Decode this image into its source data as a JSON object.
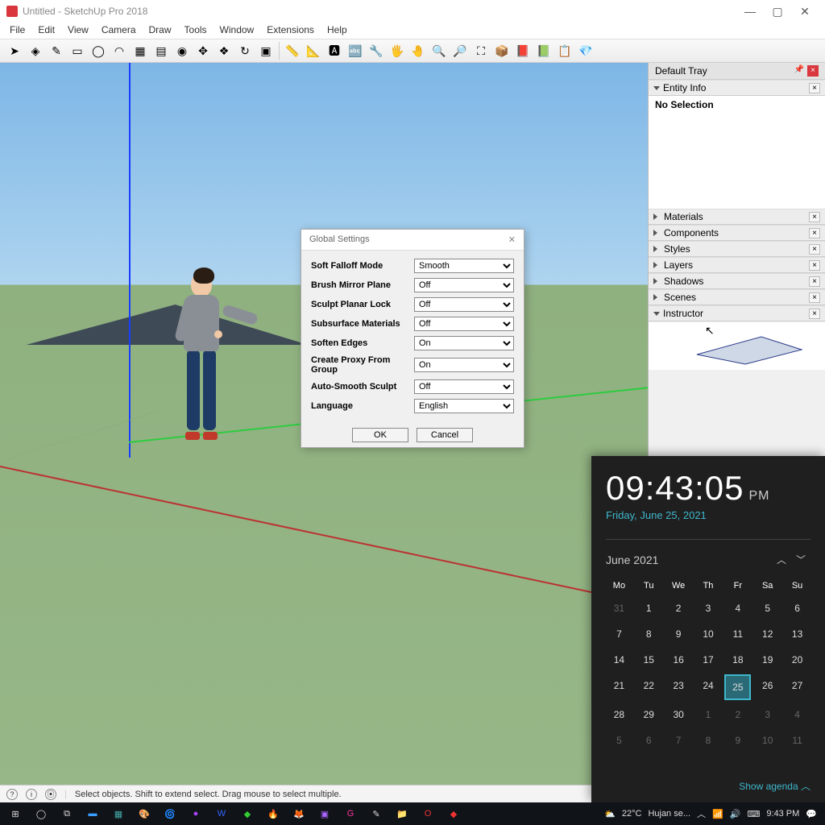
{
  "window": {
    "title": "Untitled - SketchUp Pro 2018"
  },
  "menu": [
    "File",
    "Edit",
    "View",
    "Camera",
    "Draw",
    "Tools",
    "Window",
    "Extensions",
    "Help"
  ],
  "tray": {
    "title": "Default Tray",
    "entity_info": "Entity Info",
    "no_selection": "No Selection",
    "panels": [
      "Materials",
      "Components",
      "Styles",
      "Layers",
      "Shadows",
      "Scenes",
      "Instructor"
    ]
  },
  "dialog": {
    "title": "Global Settings",
    "rows": [
      {
        "label": "Soft Falloff Mode",
        "value": "Smooth"
      },
      {
        "label": "Brush Mirror Plane",
        "value": "Off"
      },
      {
        "label": "Sculpt Planar Lock",
        "value": "Off"
      },
      {
        "label": "Subsurface Materials",
        "value": "Off"
      },
      {
        "label": "Soften Edges",
        "value": "On"
      },
      {
        "label": "Create Proxy From Group",
        "value": "On"
      },
      {
        "label": "Auto-Smooth Sculpt",
        "value": "Off"
      },
      {
        "label": "Language",
        "value": "English"
      }
    ],
    "ok": "OK",
    "cancel": "Cancel"
  },
  "clock": {
    "time": "09:43:05",
    "ampm": "PM",
    "date": "Friday, June 25, 2021",
    "month": "June 2021",
    "dow": [
      "Mo",
      "Tu",
      "We",
      "Th",
      "Fr",
      "Sa",
      "Su"
    ],
    "days": [
      {
        "n": "31",
        "dim": true
      },
      {
        "n": "1"
      },
      {
        "n": "2"
      },
      {
        "n": "3"
      },
      {
        "n": "4"
      },
      {
        "n": "5"
      },
      {
        "n": "6"
      },
      {
        "n": "7"
      },
      {
        "n": "8"
      },
      {
        "n": "9"
      },
      {
        "n": "10"
      },
      {
        "n": "11"
      },
      {
        "n": "12"
      },
      {
        "n": "13"
      },
      {
        "n": "14"
      },
      {
        "n": "15"
      },
      {
        "n": "16"
      },
      {
        "n": "17"
      },
      {
        "n": "18"
      },
      {
        "n": "19"
      },
      {
        "n": "20"
      },
      {
        "n": "21"
      },
      {
        "n": "22"
      },
      {
        "n": "23"
      },
      {
        "n": "24"
      },
      {
        "n": "25",
        "today": true
      },
      {
        "n": "26"
      },
      {
        "n": "27"
      },
      {
        "n": "28"
      },
      {
        "n": "29"
      },
      {
        "n": "30"
      },
      {
        "n": "1",
        "dim": true
      },
      {
        "n": "2",
        "dim": true
      },
      {
        "n": "3",
        "dim": true
      },
      {
        "n": "4",
        "dim": true
      },
      {
        "n": "5",
        "dim": true
      },
      {
        "n": "6",
        "dim": true
      },
      {
        "n": "7",
        "dim": true
      },
      {
        "n": "8",
        "dim": true
      },
      {
        "n": "9",
        "dim": true
      },
      {
        "n": "10",
        "dim": true
      },
      {
        "n": "11",
        "dim": true
      }
    ],
    "agenda": "Show agenda"
  },
  "status": {
    "hint": "Select objects. Shift to extend select. Drag mouse to select multiple."
  },
  "taskbar": {
    "weather_temp": "22°C",
    "weather_text": "Hujan se...",
    "time": "9:43 PM"
  },
  "tool_glyphs": [
    "➤",
    "◈",
    "✎",
    "▭",
    "◯",
    "◠",
    "▦",
    "▤",
    "◉",
    "✥",
    "❖",
    "↻",
    "▣",
    "",
    "📏",
    "📐",
    "🅰",
    "🔤",
    "🔧",
    "🖐",
    "🤚",
    "🔍",
    "🔎",
    "⛶",
    "📦",
    "📕",
    "📗",
    "📋",
    "💎"
  ]
}
